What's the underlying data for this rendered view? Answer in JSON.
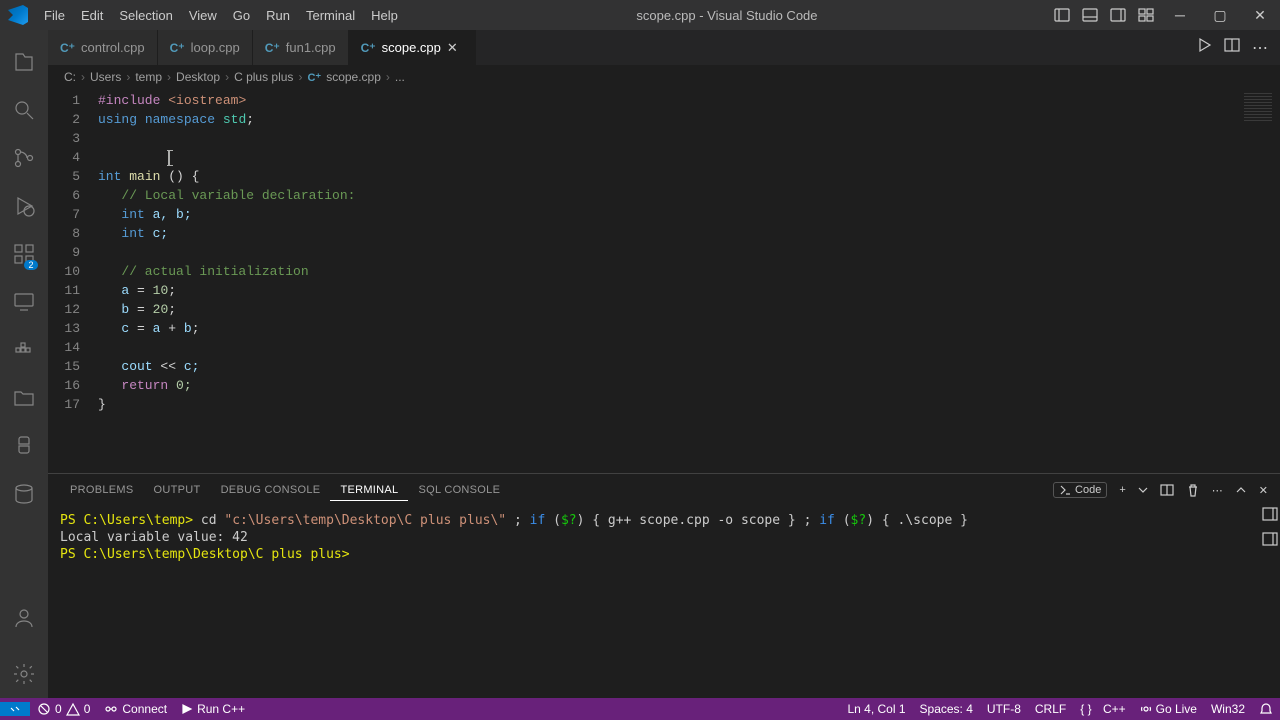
{
  "titlebar": {
    "menus": [
      "File",
      "Edit",
      "Selection",
      "View",
      "Go",
      "Run",
      "Terminal",
      "Help"
    ],
    "title": "scope.cpp - Visual Studio Code"
  },
  "activity": {
    "ext_badge": "2"
  },
  "tabs": [
    {
      "label": "control.cpp",
      "active": false
    },
    {
      "label": "loop.cpp",
      "active": false
    },
    {
      "label": "fun1.cpp",
      "active": false
    },
    {
      "label": "scope.cpp",
      "active": true
    }
  ],
  "breadcrumb": [
    "C:",
    "Users",
    "temp",
    "Desktop",
    "C plus plus",
    "scope.cpp",
    "..."
  ],
  "code": {
    "l1_include": "#include",
    "l1_lib": "<iostream>",
    "l2_using": "using",
    "l2_ns": "namespace",
    "l2_std": "std",
    "l5_int": "int",
    "l5_main": "main",
    "l5_paren": "()",
    "l5_brace": "{",
    "l6_comment": "// Local variable declaration:",
    "l7_int": "int",
    "l7_vars": "a, b;",
    "l8_int": "int",
    "l8_var": "c;",
    "l10_comment": "// actual initialization",
    "l11": "a = 10;",
    "l12": "b = 20;",
    "l13": "c = a + b;",
    "l15_cout": "cout",
    "l15_op": " << ",
    "l15_c": "c;",
    "l16_return": "return",
    "l16_v": "0;",
    "l17": "}"
  },
  "line_numbers": [
    "1",
    "2",
    "3",
    "4",
    "5",
    "6",
    "7",
    "8",
    "9",
    "10",
    "11",
    "12",
    "13",
    "14",
    "15",
    "16",
    "17"
  ],
  "panel_tabs": [
    "PROBLEMS",
    "OUTPUT",
    "DEBUG CONSOLE",
    "TERMINAL",
    "SQL CONSOLE"
  ],
  "panel_active": 3,
  "panel_action_label": "Code",
  "terminal": {
    "line1_prompt": "PS C:\\Users\\temp>",
    "line1_cd": "cd",
    "line1_path": "\"c:\\Users\\temp\\Desktop\\C plus plus\\\"",
    "line1_sep1": " ; ",
    "line1_if1": "if",
    "line1_cond1": "($?)",
    "line1_body1": "{ g++ scope.cpp -o scope }",
    "line1_sep2": " ; ",
    "line1_if2": "if",
    "line1_cond2": "($?)",
    "line1_body2": "{ .\\scope }",
    "line2": "Local variable value: 42",
    "line3": "PS C:\\Users\\temp\\Desktop\\C plus plus>"
  },
  "status": {
    "errors": "0",
    "warnings": "0",
    "connect": "Connect",
    "run": "Run C++",
    "lncol": "Ln 4, Col 1",
    "spaces": "Spaces: 4",
    "encoding": "UTF-8",
    "eol": "CRLF",
    "lang": "C++",
    "golive": "Go Live",
    "win": "Win32"
  }
}
